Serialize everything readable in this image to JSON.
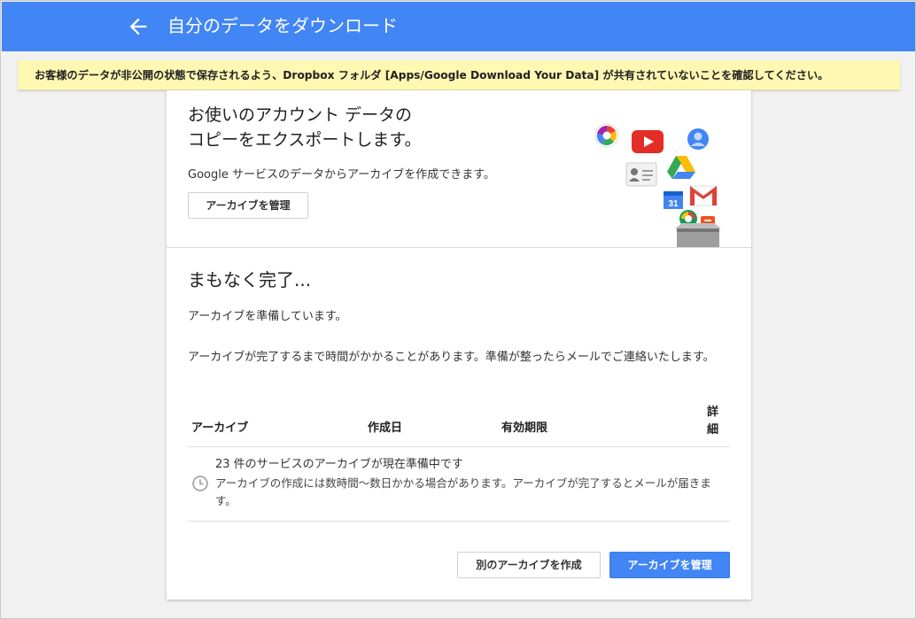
{
  "header": {
    "title": "自分のデータをダウンロード",
    "back_icon": "arrow-left-icon",
    "color": "#4285f4"
  },
  "banner": {
    "text": "お客様のデータが非公開の状態で保存されるよう、Dropbox フォルダ [Apps/Google Download Your Data] が共有されていないことを確認してください。",
    "color": "#fff8b3"
  },
  "intro": {
    "title_line1": "お使いのアカウント データの",
    "title_line2": "コピーをエクスポートします。",
    "description": "Google サービスのデータからアーカイブを作成できます。",
    "manage_button": "アーカイブを管理",
    "icons": [
      "picasa-icon",
      "youtube-icon",
      "contacts-icon",
      "profile-card-icon",
      "drive-icon",
      "calendar-icon",
      "gmail-icon",
      "hangouts-icon",
      "blogger-icon",
      "archive-box-icon"
    ]
  },
  "status": {
    "title": "まもなく完了...",
    "subtitle": "アーカイブを準備しています。",
    "description": "アーカイブが完了するまで時間がかかることがあります。準備が整ったらメールでご連絡いたします。"
  },
  "table": {
    "headers": {
      "archive": "アーカイブ",
      "created": "作成日",
      "expires": "有効期限",
      "details": "詳細"
    },
    "rows": [
      {
        "icon": "clock-icon",
        "title": "23 件のサービスのアーカイブが現在準備中です",
        "description": "アーカイブの作成には数時間〜数日かかる場合があります。アーカイブが完了するとメールが届きます。"
      }
    ]
  },
  "actions": {
    "create_another": "別のアーカイブを作成",
    "manage": "アーカイブを管理",
    "primary_color": "#4285f4"
  }
}
